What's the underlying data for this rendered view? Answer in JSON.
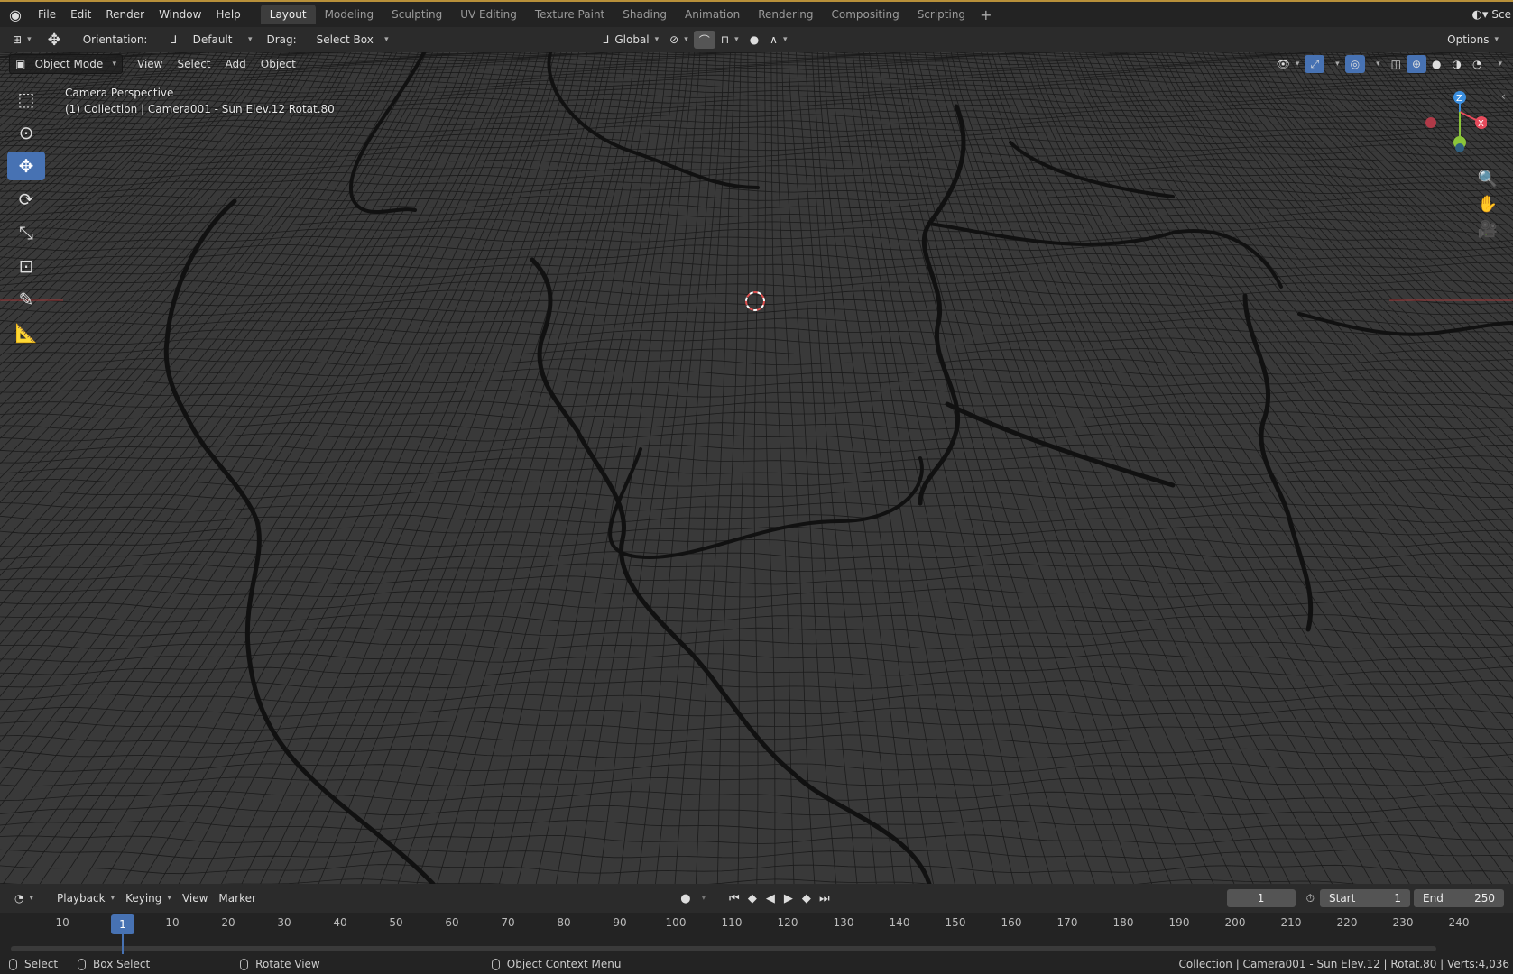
{
  "topbar": {
    "menus": [
      "File",
      "Edit",
      "Render",
      "Window",
      "Help"
    ],
    "workspaces": [
      "Layout",
      "Modeling",
      "Sculpting",
      "UV Editing",
      "Texture Paint",
      "Shading",
      "Animation",
      "Rendering",
      "Compositing",
      "Scripting"
    ],
    "active_workspace": "Layout",
    "scene_label": "Sce",
    "add_workspace_icon": "plus-icon"
  },
  "toolhead": {
    "orientation_label": "Orientation:",
    "orientation_value": "Default",
    "drag_label": "Drag:",
    "drag_value": "Select Box",
    "transform_orientation": "Global",
    "options_label": "Options"
  },
  "viewport_header": {
    "mode": "Object Mode",
    "menus": [
      "View",
      "Select",
      "Add",
      "Object"
    ]
  },
  "viewport_overlay": {
    "line1": "Camera Perspective",
    "line2": "(1) Collection | Camera001 - Sun Elev.12  Rotat.80"
  },
  "gizmo": {
    "z": "Z",
    "x": "X",
    "colors": {
      "x": "#e64b5c",
      "y": "#8bc53a",
      "z": "#3b8fe0"
    }
  },
  "timeline_header": {
    "menus": [
      "Playback",
      "Keying",
      "View",
      "Marker"
    ],
    "current_frame": "1",
    "start_label": "Start",
    "start_value": "1",
    "end_label": "End",
    "end_value": "250"
  },
  "timeline": {
    "ticks": [
      "-10",
      "1",
      "10",
      "20",
      "30",
      "40",
      "50",
      "60",
      "70",
      "80",
      "90",
      "100",
      "110",
      "120",
      "130",
      "140",
      "150",
      "160",
      "170",
      "180",
      "190",
      "200",
      "210",
      "220",
      "230",
      "240"
    ],
    "current": "1"
  },
  "statusbar": {
    "select": "Select",
    "box_select": "Box Select",
    "rotate_view": "Rotate View",
    "context_menu": "Object Context Menu",
    "info": "Collection | Camera001 - Sun Elev.12 | Rotat.80 | Verts:4,036"
  },
  "colors": {
    "accent": "#4772b3",
    "header": "#2b2b2b",
    "viewport": "#393939"
  }
}
